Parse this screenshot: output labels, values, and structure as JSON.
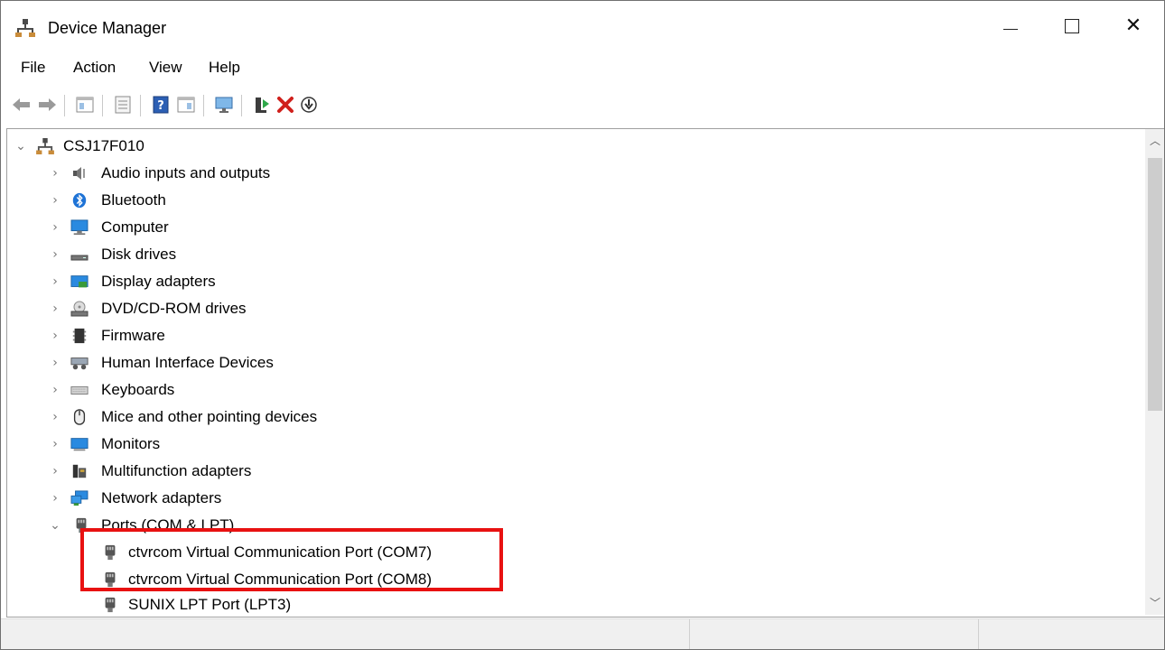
{
  "window": {
    "title": "Device Manager"
  },
  "menu": {
    "items": [
      "File",
      "Action",
      "View",
      "Help"
    ]
  },
  "toolbar": {
    "buttons": [
      {
        "icon": "back-arrow-icon"
      },
      {
        "icon": "forward-arrow-icon"
      },
      {
        "icon": "show-hide-console-tree-icon"
      },
      {
        "icon": "properties-icon"
      },
      {
        "icon": "help-icon"
      },
      {
        "icon": "action-pane-icon"
      },
      {
        "icon": "scan-hardware-changes-icon"
      },
      {
        "icon": "update-driver-icon"
      },
      {
        "icon": "uninstall-device-icon"
      },
      {
        "icon": "disable-device-icon"
      }
    ]
  },
  "tree": {
    "root": "CSJ17F010",
    "categories": [
      {
        "label": "Audio inputs and outputs",
        "icon": "speaker-icon"
      },
      {
        "label": "Bluetooth",
        "icon": "bluetooth-icon"
      },
      {
        "label": "Computer",
        "icon": "computer-icon"
      },
      {
        "label": "Disk drives",
        "icon": "disk-drive-icon"
      },
      {
        "label": "Display adapters",
        "icon": "display-adapter-icon"
      },
      {
        "label": "DVD/CD-ROM drives",
        "icon": "dvd-drive-icon"
      },
      {
        "label": "Firmware",
        "icon": "firmware-icon"
      },
      {
        "label": "Human Interface Devices",
        "icon": "hid-icon"
      },
      {
        "label": "Keyboards",
        "icon": "keyboard-icon"
      },
      {
        "label": "Mice and other pointing devices",
        "icon": "mouse-icon"
      },
      {
        "label": "Monitors",
        "icon": "monitor-icon"
      },
      {
        "label": "Multifunction adapters",
        "icon": "multifunction-adapter-icon"
      },
      {
        "label": "Network adapters",
        "icon": "network-adapter-icon"
      },
      {
        "label": "Ports (COM & LPT)",
        "icon": "port-icon"
      }
    ],
    "ports_children": [
      {
        "label": "ctvrcom Virtual Communication Port (COM7)",
        "icon": "port-icon"
      },
      {
        "label": "ctvrcom Virtual Communication Port (COM8)",
        "icon": "port-icon"
      },
      {
        "label": "SUNIX LPT Port (LPT3)",
        "icon": "port-icon"
      }
    ]
  },
  "colors": {
    "highlight": "#e81111",
    "accent_blue": "#1e73d6"
  }
}
